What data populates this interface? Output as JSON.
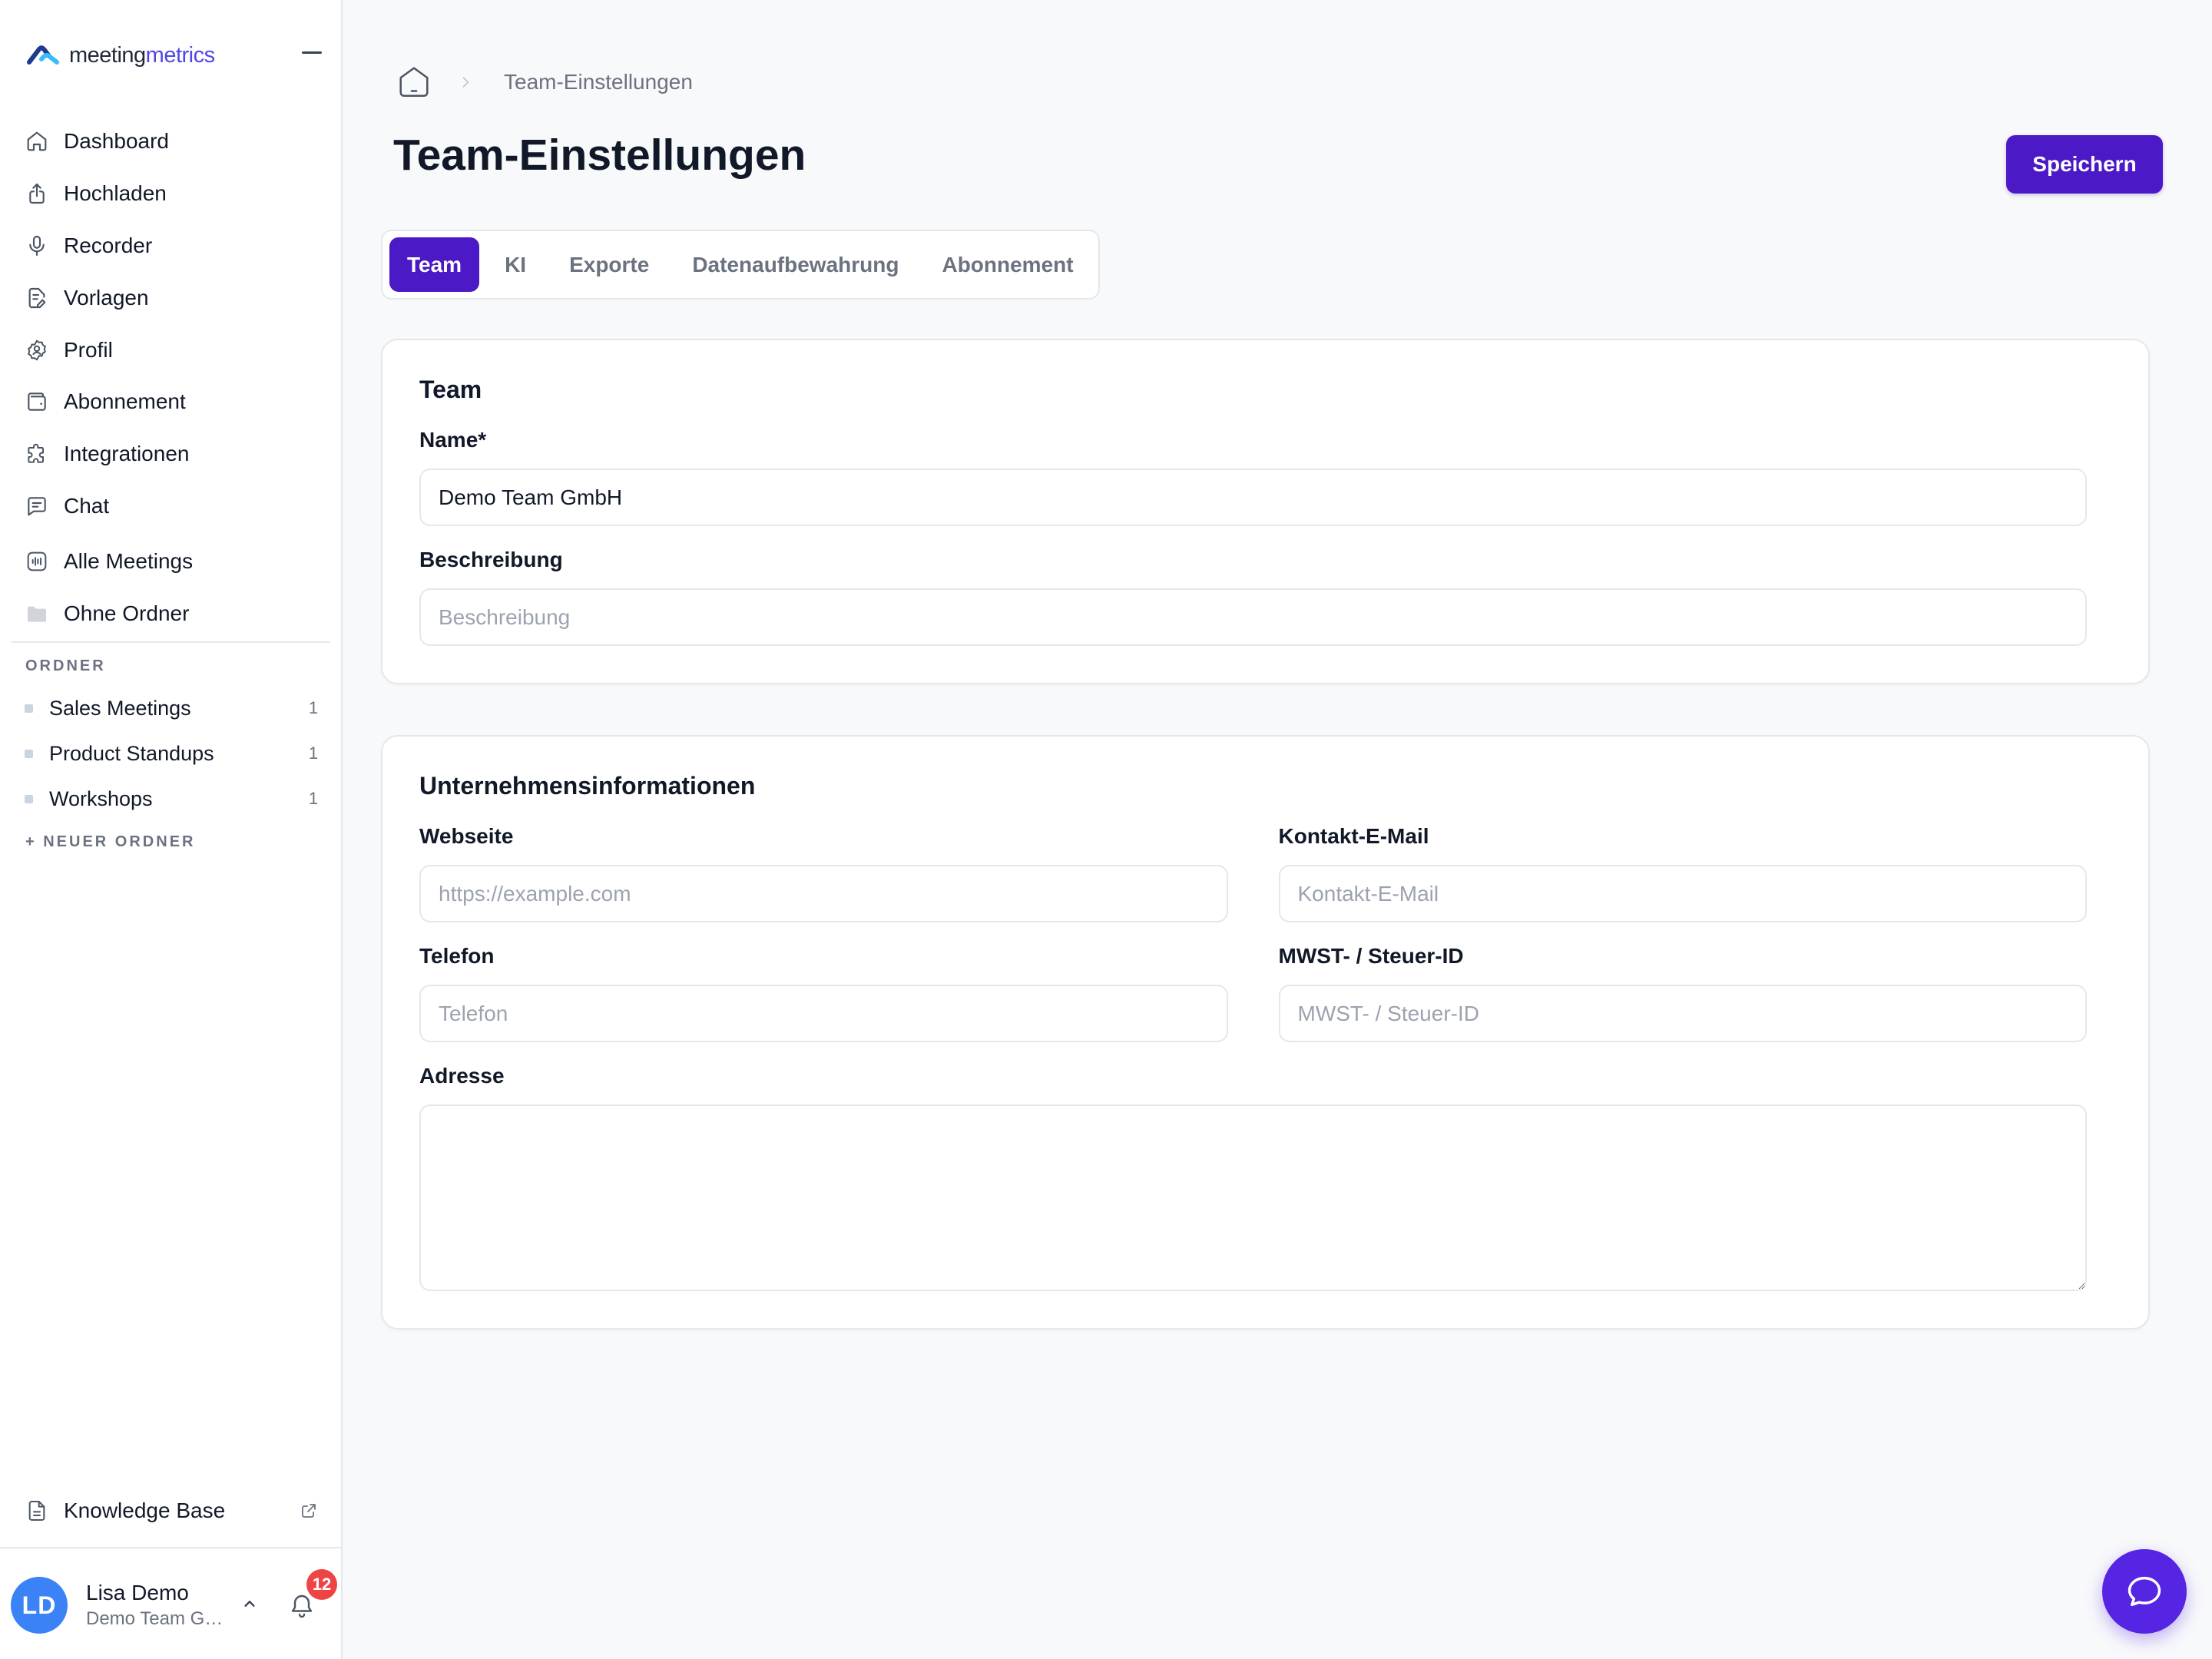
{
  "colors": {
    "accent": "#4b19c6",
    "chat_launcher": "#5624e3",
    "badge": "#ef4444",
    "avatar": "#3b82f6",
    "logo_accent": "#4f46e5"
  },
  "app": {
    "logo_primary": "meeting",
    "logo_accent": "metrics"
  },
  "sidebar": {
    "nav": [
      {
        "label": "Dashboard",
        "icon": "home-icon"
      },
      {
        "label": "Hochladen",
        "icon": "upload-icon"
      },
      {
        "label": "Recorder",
        "icon": "microphone-icon"
      },
      {
        "label": "Vorlagen",
        "icon": "template-icon"
      },
      {
        "label": "Profil",
        "icon": "profile-icon"
      },
      {
        "label": "Abonnement",
        "icon": "wallet-icon"
      },
      {
        "label": "Integrationen",
        "icon": "puzzle-icon"
      },
      {
        "label": "Chat",
        "icon": "chat-icon"
      },
      {
        "label": "Alle Meetings",
        "icon": "waveform-icon"
      },
      {
        "label": "Ohne Ordner",
        "icon": "folder-icon"
      }
    ],
    "folders": {
      "heading": "ORDNER",
      "items": [
        {
          "label": "Sales Meetings",
          "count": "1"
        },
        {
          "label": "Product Standups",
          "count": "1"
        },
        {
          "label": "Workshops",
          "count": "1"
        }
      ],
      "new_folder_label": "+ NEUER ORDNER"
    },
    "knowledge_base": {
      "label": "Knowledge Base",
      "icon": "document-icon",
      "trailing_icon": "external-link-icon"
    },
    "user": {
      "initials": "LD",
      "name": "Lisa Demo",
      "team": "Demo Team G…"
    },
    "notifications": {
      "count": "12",
      "icon": "bell-icon"
    }
  },
  "breadcrumb": {
    "home_icon": "home-icon",
    "current": "Team-Einstellungen"
  },
  "page": {
    "title": "Team-Einstellungen",
    "save_label": "Speichern"
  },
  "tabs": [
    {
      "label": "Team",
      "active": true
    },
    {
      "label": "KI",
      "active": false
    },
    {
      "label": "Exporte",
      "active": false
    },
    {
      "label": "Datenaufbewahrung",
      "active": false
    },
    {
      "label": "Abonnement",
      "active": false
    }
  ],
  "team_card": {
    "heading": "Team",
    "name_label": "Name*",
    "name_value": "Demo Team GmbH",
    "description_label": "Beschreibung",
    "description_placeholder": "Beschreibung"
  },
  "company_card": {
    "heading": "Unternehmensinformationen",
    "website_label": "Webseite",
    "website_placeholder": "https://example.com",
    "email_label": "Kontakt-E-Mail",
    "email_placeholder": "Kontakt-E-Mail",
    "phone_label": "Telefon",
    "phone_placeholder": "Telefon",
    "tax_label": "MWST- / Steuer-ID",
    "tax_placeholder": "MWST- / Steuer-ID",
    "address_label": "Adresse"
  },
  "support_chat": {
    "icon": "chat-bubble-icon"
  }
}
